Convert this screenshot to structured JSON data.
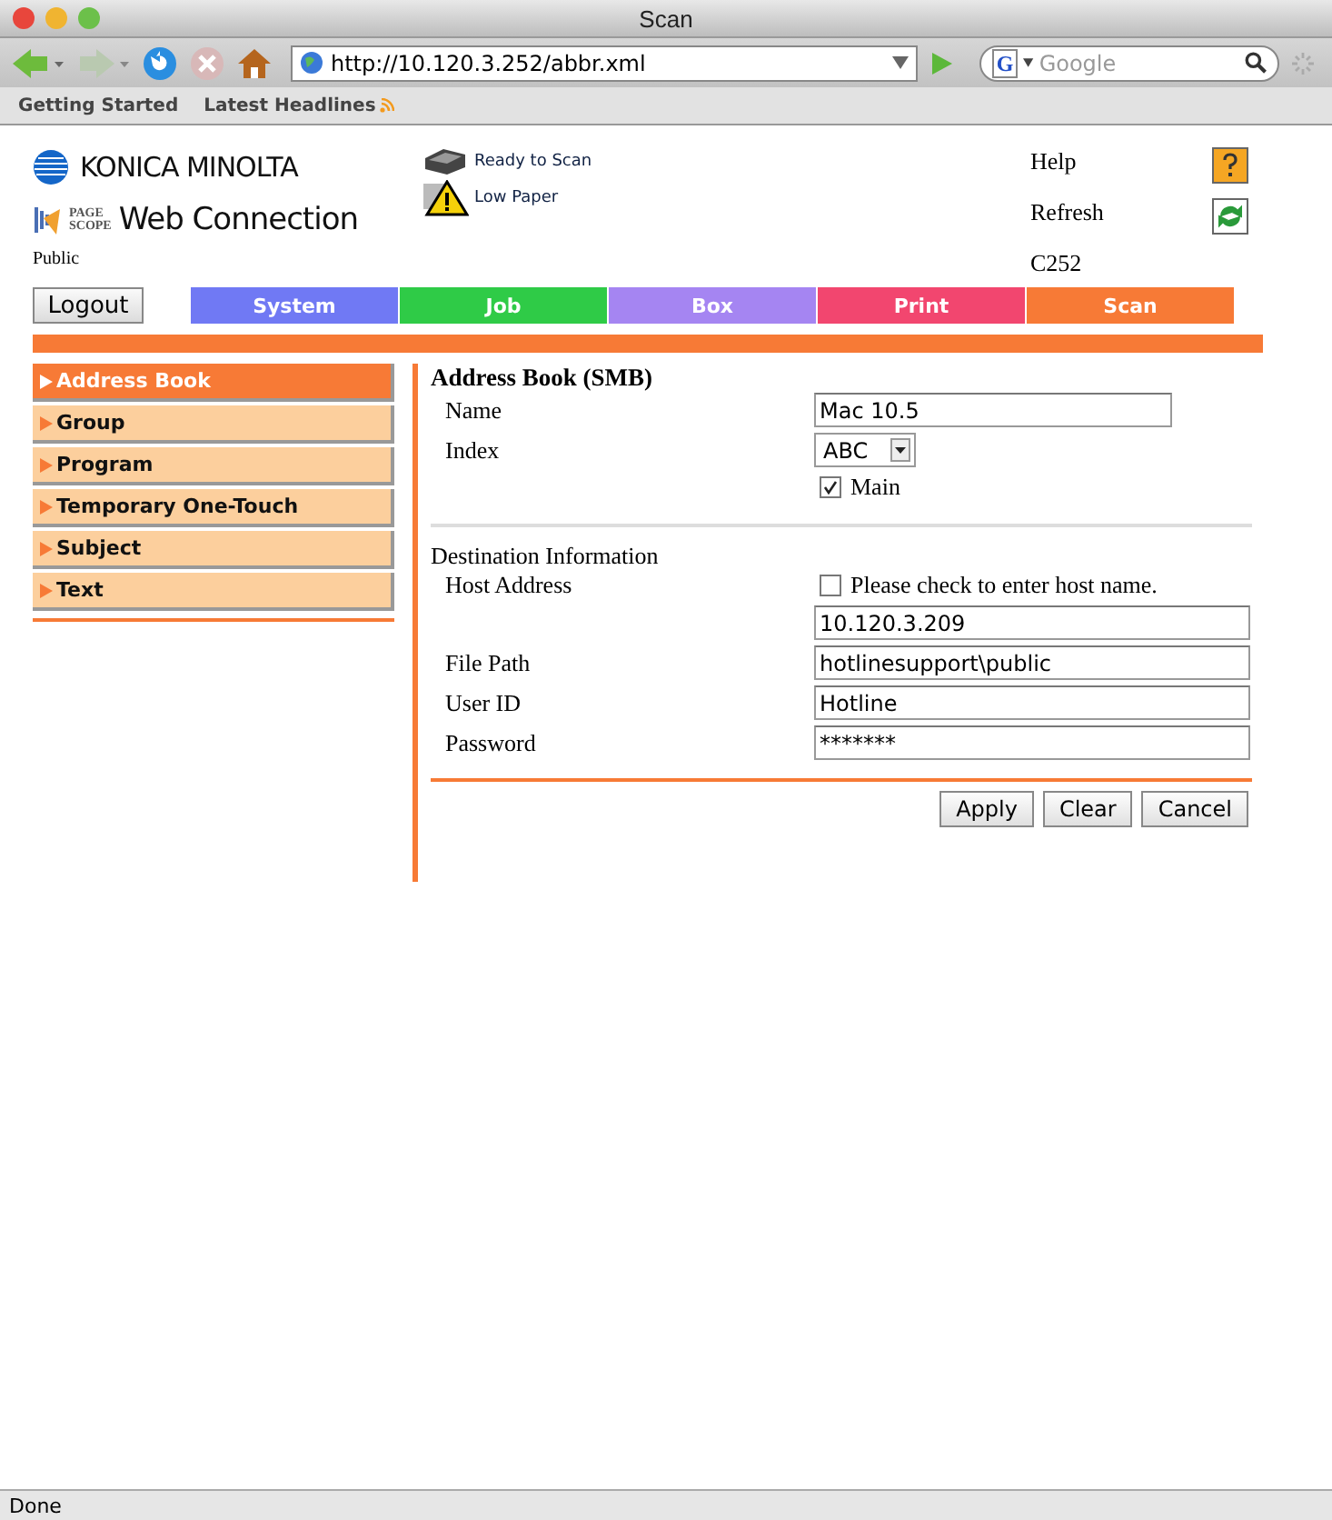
{
  "window": {
    "title": "Scan"
  },
  "browser": {
    "url": "http://10.120.3.252/abbr.xml",
    "search_badge": "G",
    "search_placeholder": "Google",
    "bookmarks": [
      "Getting Started",
      "Latest Headlines"
    ]
  },
  "header": {
    "brand": "KONICA MINOLTA",
    "product_badge_top": "PAGE",
    "product_badge_bottom": "SCOPE",
    "product": "Web Connection",
    "user": "Public",
    "status": [
      {
        "kind": "printer",
        "text": "Ready to Scan"
      },
      {
        "kind": "warning",
        "text": "Low Paper"
      }
    ],
    "help": "Help",
    "refresh": "Refresh",
    "model": "C252"
  },
  "logout": "Logout",
  "tabs": [
    {
      "label": "System",
      "color": "#7079f4"
    },
    {
      "label": "Job",
      "color": "#2fcb47"
    },
    {
      "label": "Box",
      "color": "#a585f2"
    },
    {
      "label": "Print",
      "color": "#f2466f"
    },
    {
      "label": "Scan",
      "color": "#f77a36"
    }
  ],
  "sidebar": {
    "items": [
      {
        "label": "Address Book",
        "selected": true
      },
      {
        "label": "Group",
        "selected": false
      },
      {
        "label": "Program",
        "selected": false
      },
      {
        "label": "Temporary One-Touch",
        "selected": false
      },
      {
        "label": "Subject",
        "selected": false
      },
      {
        "label": "Text",
        "selected": false
      }
    ]
  },
  "form": {
    "title": "Address Book (SMB)",
    "name_label": "Name",
    "name": "Mac 10.5",
    "index_label": "Index",
    "index": "ABC",
    "main_label": "Main",
    "main_checked": true,
    "section": "Destination Information",
    "host_label": "Host Address",
    "host_check_label": "Please check to enter host name.",
    "host_checked": false,
    "host": "10.120.3.209",
    "path_label": "File Path",
    "path": "hotlinesupport\\public",
    "user_label": "User ID",
    "user": "Hotline",
    "password_label": "Password",
    "password": "*******"
  },
  "buttons": [
    "Apply",
    "Clear",
    "Cancel"
  ],
  "status_bar": "Done"
}
